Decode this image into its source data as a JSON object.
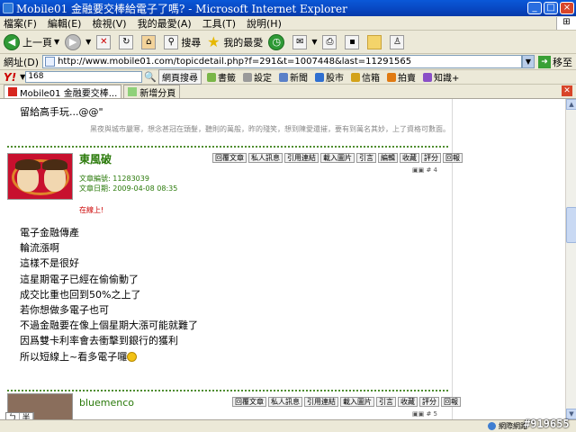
{
  "window": {
    "title": "Mobile01 金融要交棒給電子了嗎? - Microsoft Internet Explorer",
    "minimize": "_",
    "maximize": "□",
    "close": "×"
  },
  "menu": [
    "檔案(F)",
    "編輯(E)",
    "檢視(V)",
    "我的最愛(A)",
    "工具(T)",
    "說明(H)"
  ],
  "toolbar": {
    "back": "上一頁",
    "search": "搜尋",
    "favorites": "我的最愛"
  },
  "address": {
    "label": "網址(D)",
    "url": "http://www.mobile01.com/topicdetail.php?f=291&t=1007448&last=11291565",
    "go": "移至"
  },
  "yahoo": {
    "logo": "Y!",
    "search_value": "168",
    "search_button": "網頁搜尋",
    "items": [
      "書籤",
      "設定",
      "新聞",
      "股市",
      "信箱",
      "拍賣",
      "知識+"
    ]
  },
  "tabs": [
    {
      "label": "Mobile01 金融要交棒..."
    },
    {
      "label": "新增分頁"
    }
  ],
  "thread": {
    "lead_text": "留給高手玩...@@\"",
    "signature": "黑夜與城市嚴寒，想念甚冠在頭髮，聽則的萬般，昨的殘笑，想到陳愛還摧，要有到萬名其妙，上了資格可數面。",
    "post": {
      "username": "東風破",
      "meta_lines": [
        "文章編號: 11283039",
        "文章日期: 2009-04-08 08:35"
      ],
      "online": "在線上!",
      "buttons": [
        "回覆文章",
        "私人訊息",
        "引用連結",
        "載入圖片",
        "引言",
        "編輯",
        "收藏",
        "評分",
        "回報"
      ],
      "post_number": "▣▣ # 4",
      "body_lines": [
        "電子金融傳產",
        "輪流漲啊",
        "這樣不是很好",
        "這星期電子已經在偷偷動了",
        "成交比重也回到50%之上了",
        "若你想做多電子也可",
        "不過金融要在像上個星期大漲可能就難了",
        "因爲雙卡利率會去衝擊到銀行的獲利",
        "所以短線上~看多電子囉"
      ]
    },
    "next_post": {
      "username": "bluemenco",
      "buttons": [
        "回覆文章",
        "私人訊息",
        "引用連結",
        "載入圖片",
        "引言",
        "收藏",
        "評分",
        "回報"
      ],
      "post_number": "▣▣ # 5"
    }
  },
  "ime": [
    "ㄅ",
    "半"
  ],
  "status": {
    "zone": "網際網路",
    "watermark": "#919655"
  }
}
